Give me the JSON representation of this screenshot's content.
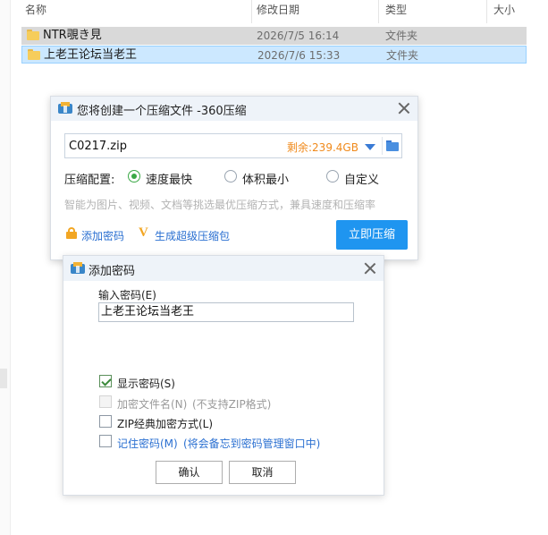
{
  "explorer": {
    "columns": {
      "name": "名称",
      "date": "修改日期",
      "type": "类型",
      "size": "大小"
    },
    "files": [
      {
        "name": "NTR覗き見",
        "date": "2026/7/5 16:14",
        "type": "文件夹"
      },
      {
        "name": "上老王论坛当老王",
        "date": "2026/7/6 15:33",
        "type": "文件夹"
      }
    ]
  },
  "compress_dialog": {
    "title": "您将创建一个压缩文件 -360压缩",
    "filename": "C0217.zip",
    "remaining": "剩余:239.4GB",
    "config_label": "压缩配置:",
    "options": [
      "速度最快",
      "体积最小",
      "自定义"
    ],
    "selected_option": "速度最快",
    "hint": "智能为图片、视频、文档等挑选最优压缩方式，兼具速度和压缩率",
    "add_password": "添加密码",
    "super_pack": "生成超级压缩包",
    "compress_now": "立即压缩"
  },
  "password_dialog": {
    "title": "添加密码",
    "field_label": "输入密码(E)",
    "password_value": "上老王论坛当老王",
    "show_password": "显示密码(S)",
    "show_password_checked": true,
    "encrypt_filenames": "加密文件名(N)",
    "encrypt_filenames_note": "(不支持ZIP格式)",
    "zip_classic": "ZIP经典加密方式(L)",
    "remember": "记住密码(M)",
    "remember_note": "(将会备忘到密码管理窗口中)",
    "ok": "确认",
    "cancel": "取消"
  },
  "colors": {
    "accent_blue": "#1f95f0",
    "selection_blue": "#cce8ff",
    "remain_orange": "#f08a1c",
    "radio_green": "#3aa845"
  }
}
